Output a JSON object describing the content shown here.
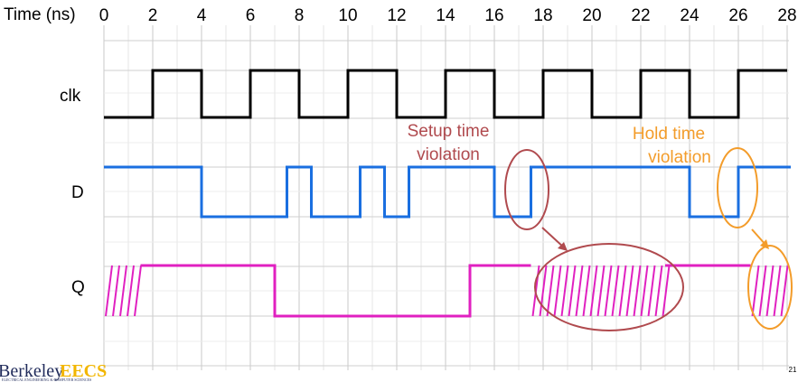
{
  "axis": {
    "title": "Time (ns)",
    "ticks": [
      "0",
      "2",
      "4",
      "6",
      "8",
      "10",
      "12",
      "14",
      "16",
      "18",
      "20",
      "22",
      "24",
      "26",
      "28"
    ]
  },
  "signals": [
    {
      "name": "clk",
      "color": "#000000",
      "transitions": [
        0,
        2,
        4,
        6,
        8,
        10,
        12,
        14,
        16,
        18,
        20,
        22,
        24,
        26,
        28
      ],
      "initial": 0
    },
    {
      "name": "D",
      "color": "#1a6fe0",
      "transitions": [
        0,
        4,
        7.5,
        8.5,
        10.5,
        11.5,
        12.5,
        16,
        17.5,
        24,
        26
      ],
      "initial": 1
    },
    {
      "name": "Q",
      "color": "#e020c0",
      "unknown_ranges": [
        [
          0,
          1.5
        ],
        [
          17.5,
          23
        ],
        [
          26.5,
          28
        ]
      ],
      "transitions": [
        1.5,
        7,
        15,
        17.5,
        23,
        26.5
      ],
      "initial": 1
    }
  ],
  "annotations": {
    "setup": {
      "lines": [
        "Setup time",
        "violation"
      ],
      "color": "#b04a4e"
    },
    "hold": {
      "lines": [
        "Hold time",
        "violation"
      ],
      "color": "#f39c2a"
    }
  },
  "logo": {
    "text_a": "Berkeley",
    "text_b": "EECS",
    "subtitle": "ELECTRICAL ENGINEERING & COMPUTER SCIENCES"
  },
  "page_number": "21"
}
